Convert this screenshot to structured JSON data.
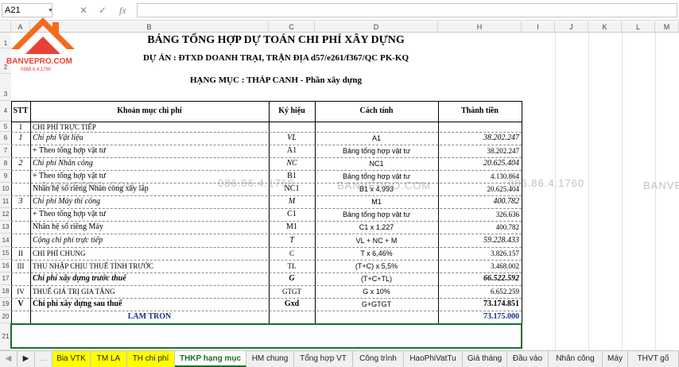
{
  "formula_bar": {
    "name_box": "A21",
    "fx_label": "fx",
    "cancel": "✕",
    "confirm": "✓"
  },
  "columns": [
    "A",
    "B",
    "C",
    "D",
    "H",
    "I",
    "J",
    "K",
    "L",
    "M"
  ],
  "rows": [
    "1",
    "2",
    "3",
    "4",
    "5",
    "6",
    "7",
    "8",
    "9",
    "10",
    "11",
    "12",
    "13",
    "14",
    "15",
    "16",
    "17",
    "18",
    "19",
    "20",
    "21"
  ],
  "logo": {
    "brand": "BANVEPRO.COM",
    "phone": "0868.6.4.1760"
  },
  "sheet": {
    "title": "BẢNG TỔNG HỢP DỰ TOÁN CHI PHÍ XÂY DỰNG",
    "project": "DỰ ÁN : ĐTXD DOANH TRẠI, TRẬN ĐỊA d57/e261/f367/QC PK-KQ",
    "category": "HẠNG MỤC : THÁP CANH - Phần xây dựng",
    "headers": {
      "stt": "STT",
      "item": "Khoản mục chi phí",
      "symbol": "Ký hiệu",
      "method": "Cách tính",
      "amount": "Thành tiền"
    },
    "lines": [
      {
        "stt": "I",
        "item": "CHI PHÍ TRỰC TIẾP",
        "symbol": "",
        "method": "",
        "amount": ""
      },
      {
        "stt": "1",
        "item": "Chi phí Vật liệu",
        "symbol": "VL",
        "method": "A1",
        "amount": "38.202.247"
      },
      {
        "stt": "",
        "item": "+ Theo tổng hợp vật tư",
        "symbol": "A1",
        "method": "Bảng tổng hợp vật tư",
        "amount": "38.202.247"
      },
      {
        "stt": "2",
        "item": "Chi phí Nhân công",
        "symbol": "NC",
        "method": "NC1",
        "amount": "20.625.404"
      },
      {
        "stt": "",
        "item": "+ Theo tổng hợp vật tư",
        "symbol": "B1",
        "method": "Bảng tổng hợp vật tư",
        "amount": "4.130.864"
      },
      {
        "stt": "",
        "item": "Nhân hệ số riêng Nhân công xây lắp",
        "symbol": "NC1",
        "method": "B1 x 4,993",
        "amount": "20.625.404"
      },
      {
        "stt": "3",
        "item": "Chi phí Máy thi công",
        "symbol": "M",
        "method": "M1",
        "amount": "400.782"
      },
      {
        "stt": "",
        "item": "+ Theo tổng hợp vật tư",
        "symbol": "C1",
        "method": "Bảng tổng hợp vật tư",
        "amount": "326.636"
      },
      {
        "stt": "",
        "item": "Nhân hệ số riêng Máy",
        "symbol": "M1",
        "method": "C1 x 1,227",
        "amount": "400.782"
      },
      {
        "stt": "",
        "item": "Cộng chi phí trực tiếp",
        "symbol": "T",
        "method": "VL + NC + M",
        "amount": "59.228.433"
      },
      {
        "stt": "II",
        "item": "CHI PHÍ CHUNG",
        "symbol": "C",
        "method": "T x 6,46%",
        "amount": "3.826.157"
      },
      {
        "stt": "III",
        "item": "THU NHẬP CHỊU THUẾ TÍNH TRƯỚC",
        "symbol": "TL",
        "method": "(T+C) x 5,5%",
        "amount": "3.468.002"
      },
      {
        "stt": "",
        "item": "Chi phí xây dựng trước thuế",
        "symbol": "G",
        "method": "(T+C+TL)",
        "amount": "66.522.592"
      },
      {
        "stt": "IV",
        "item": "THUẾ GIÁ TRỊ GIA TĂNG",
        "symbol": "GTGT",
        "method": "G x 10%",
        "amount": "6.652.259"
      },
      {
        "stt": "V",
        "item": "Chi phí xây dựng sau thuế",
        "symbol": "Gxd",
        "method": "G+GTGT",
        "amount": "73.174.851"
      },
      {
        "stt": "",
        "item": "LÀM TRÒN",
        "symbol": "",
        "method": "",
        "amount": "73.175.000"
      }
    ]
  },
  "watermark": {
    "text_a": "BANVEPRO.COM",
    "text_b": "086.86.4.1760",
    "text_c": "BANVE"
  },
  "tabs": [
    "Bia VTK",
    "TM LA",
    "TH chi phí",
    "THKP hạng mục",
    "HM chung",
    "Tổng hợp VT",
    "Công trình",
    "HaoPhiVatTu",
    "Giá tháng",
    "Đầu vào",
    "Nhân công",
    "Máy",
    "THVT gố"
  ],
  "active_tab": "THKP hạng mục"
}
